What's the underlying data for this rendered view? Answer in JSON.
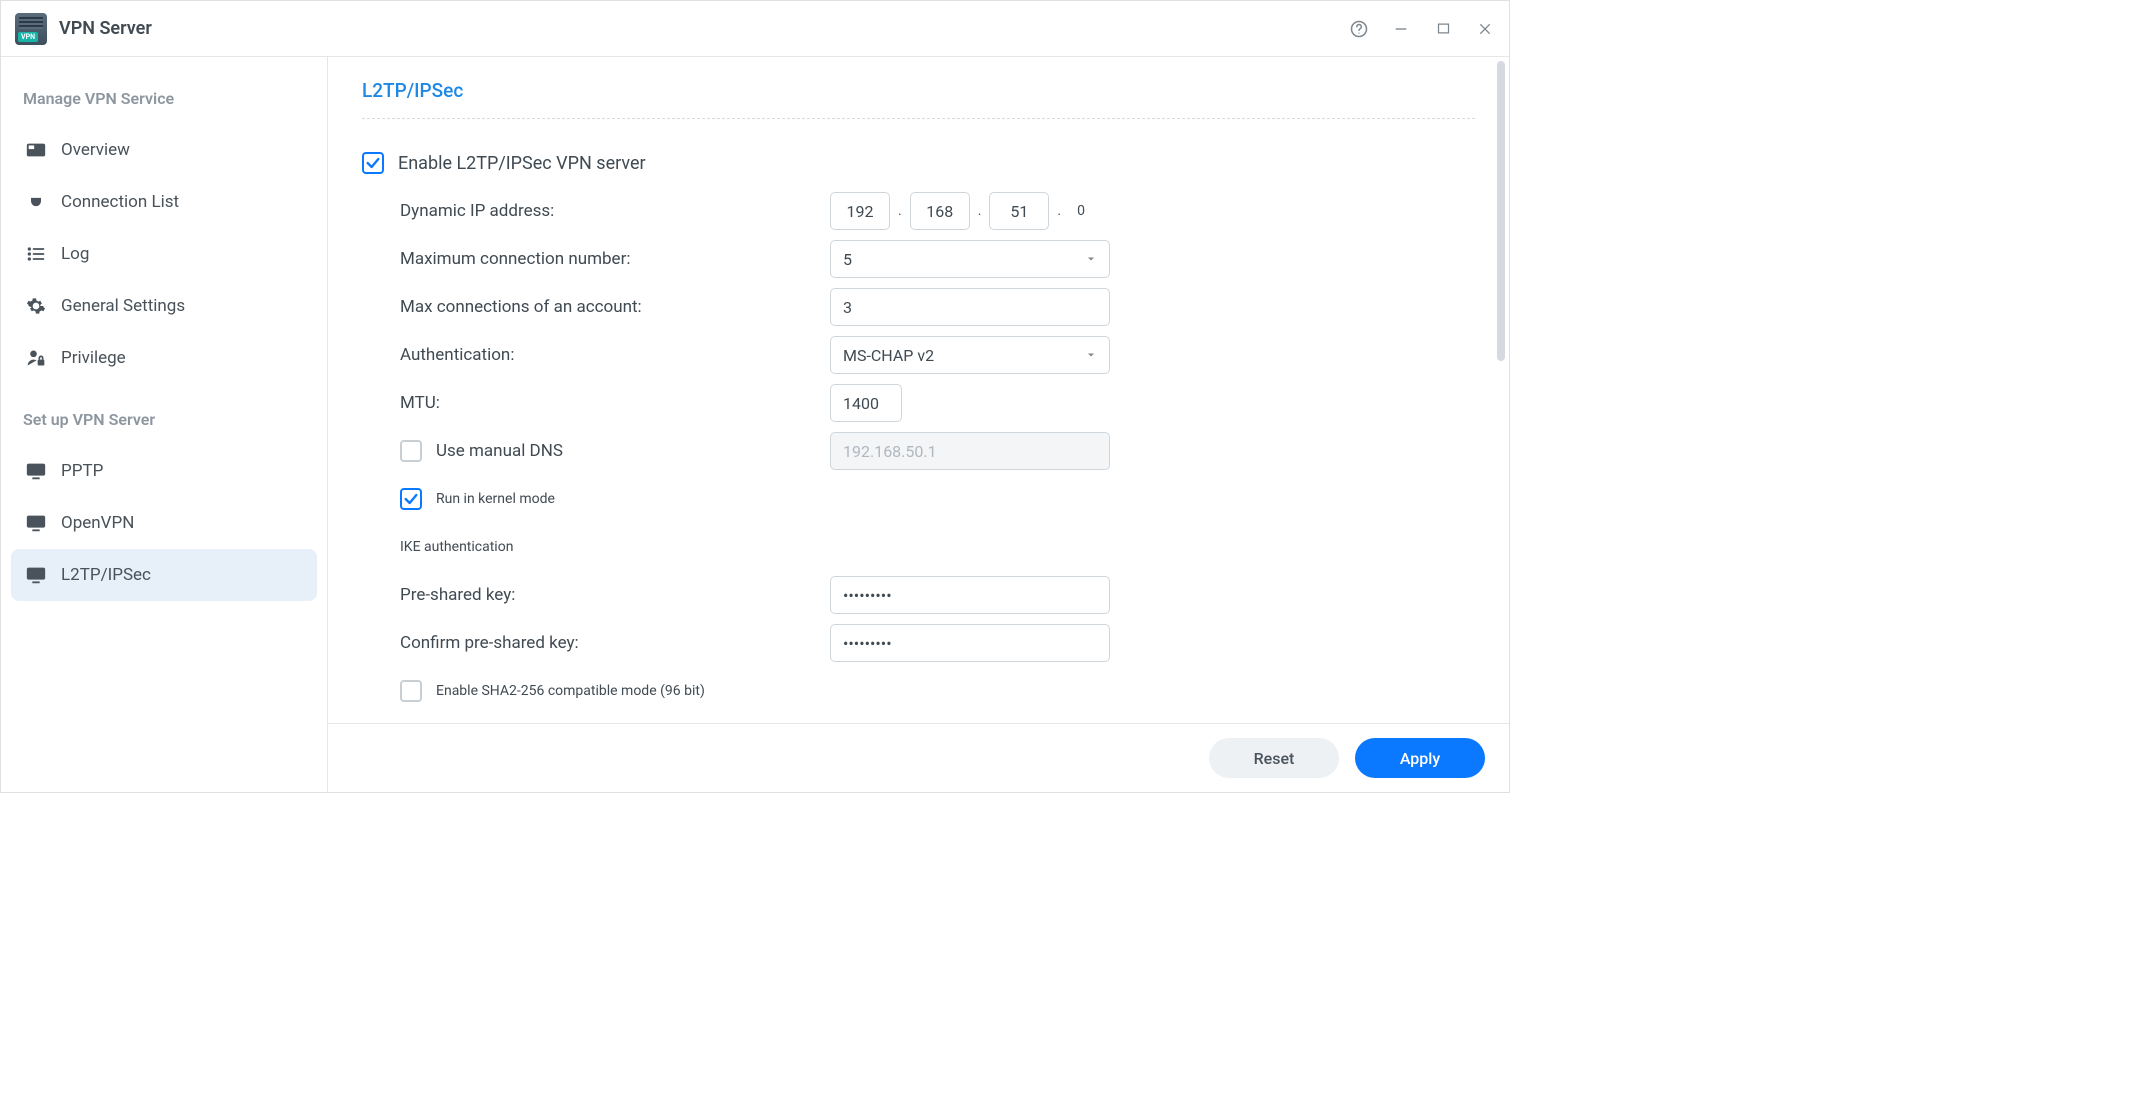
{
  "app": {
    "title": "VPN Server"
  },
  "window_controls": {
    "help": "?",
    "minimize": "–",
    "maximize": "▭",
    "close": "✕"
  },
  "sidebar": {
    "section1_label": "Manage VPN Service",
    "items1": [
      {
        "id": "overview",
        "label": "Overview"
      },
      {
        "id": "connection-list",
        "label": "Connection List"
      },
      {
        "id": "log",
        "label": "Log"
      },
      {
        "id": "general-settings",
        "label": "General Settings"
      },
      {
        "id": "privilege",
        "label": "Privilege"
      }
    ],
    "section2_label": "Set up VPN Server",
    "items2": [
      {
        "id": "pptp",
        "label": "PPTP"
      },
      {
        "id": "openvpn",
        "label": "OpenVPN"
      },
      {
        "id": "l2tp",
        "label": "L2TP/IPSec"
      }
    ],
    "active_id": "l2tp"
  },
  "page": {
    "heading": "L2TP/IPSec",
    "enable_label": "Enable L2TP/IPSec VPN server",
    "enable_checked": true,
    "dynamic_ip_label": "Dynamic IP address:",
    "ip": {
      "o1": "192",
      "o2": "168",
      "o3": "51",
      "o4_fixed": "0"
    },
    "max_conn_label": "Maximum connection number:",
    "max_conn_value": "5",
    "max_conn_acct_label": "Max connections of an account:",
    "max_conn_acct_value": "3",
    "auth_label": "Authentication:",
    "auth_value": "MS-CHAP v2",
    "mtu_label": "MTU:",
    "mtu_value": "1400",
    "manual_dns_label": "Use manual DNS",
    "manual_dns_checked": false,
    "manual_dns_value": "192.168.50.1",
    "kernel_mode_label": "Run in kernel mode",
    "kernel_mode_checked": true,
    "ike_label": "IKE authentication",
    "psk_label": "Pre-shared key:",
    "psk_value": "•••••••••",
    "psk_confirm_label": "Confirm pre-shared key:",
    "psk_confirm_value": "•••••••••",
    "sha2_label": "Enable SHA2-256 compatible mode (96 bit)",
    "sha2_checked": false
  },
  "footer": {
    "reset": "Reset",
    "apply": "Apply"
  }
}
